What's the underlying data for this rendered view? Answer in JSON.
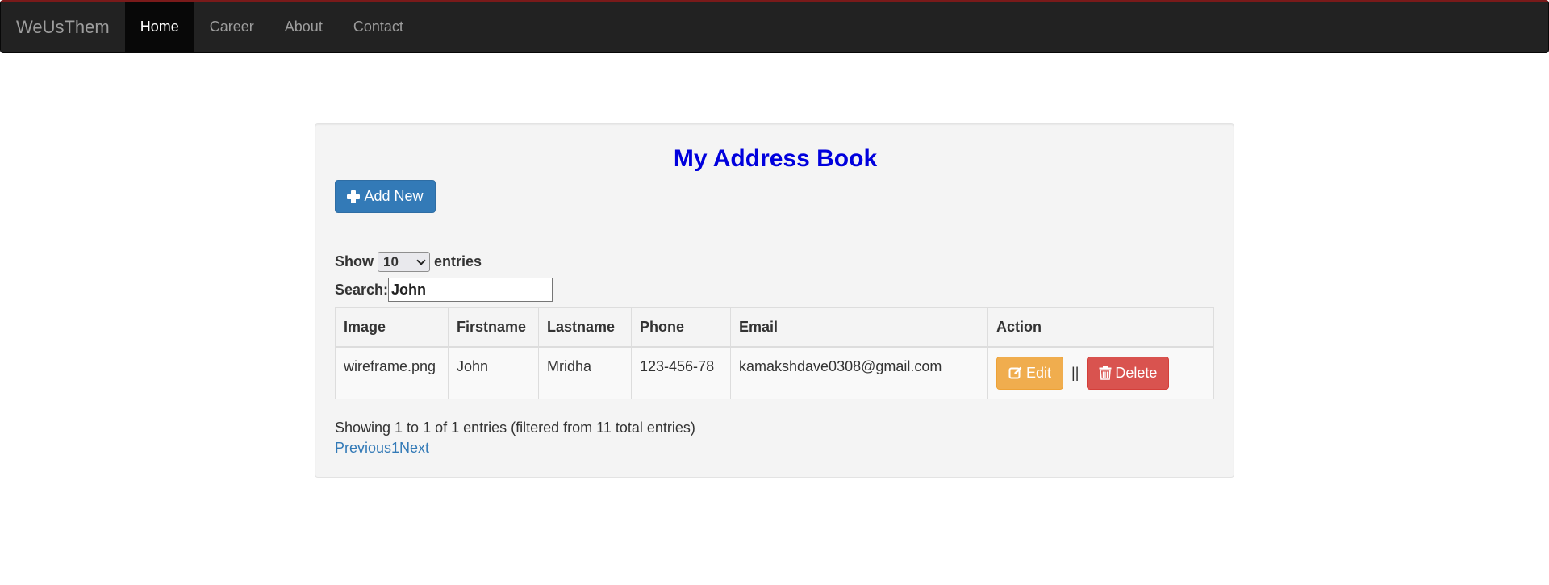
{
  "navbar": {
    "brand": "WeUsThem",
    "items": [
      {
        "label": "Home",
        "active": true
      },
      {
        "label": "Career",
        "active": false
      },
      {
        "label": "About",
        "active": false
      },
      {
        "label": "Contact",
        "active": false
      }
    ]
  },
  "page": {
    "title": "My Address Book",
    "add_label": "Add New",
    "show_label": "Show",
    "page_size": "10",
    "entries_label": "entries",
    "search_label": "Search:",
    "search_value": "John"
  },
  "table": {
    "headers": [
      "Image",
      "Firstname",
      "Lastname",
      "Phone",
      "Email",
      "Action"
    ],
    "rows": [
      {
        "image": "wireframe.png",
        "firstname": "John",
        "lastname": "Mridha",
        "phone": "123-456-78",
        "email": "kamakshdave0308@gmail.com",
        "edit_label": "Edit",
        "separator": "||",
        "delete_label": "Delete"
      }
    ]
  },
  "footer": {
    "info": "Showing 1 to 1 of 1 entries (filtered from 11 total entries)",
    "previous": "Previous",
    "page_number": "1",
    "next": "Next"
  },
  "colors": {
    "title": "#0000dd",
    "primary": "#337ab7",
    "warning": "#f0ad4e",
    "danger": "#d9534f",
    "navbar": "#222222"
  }
}
